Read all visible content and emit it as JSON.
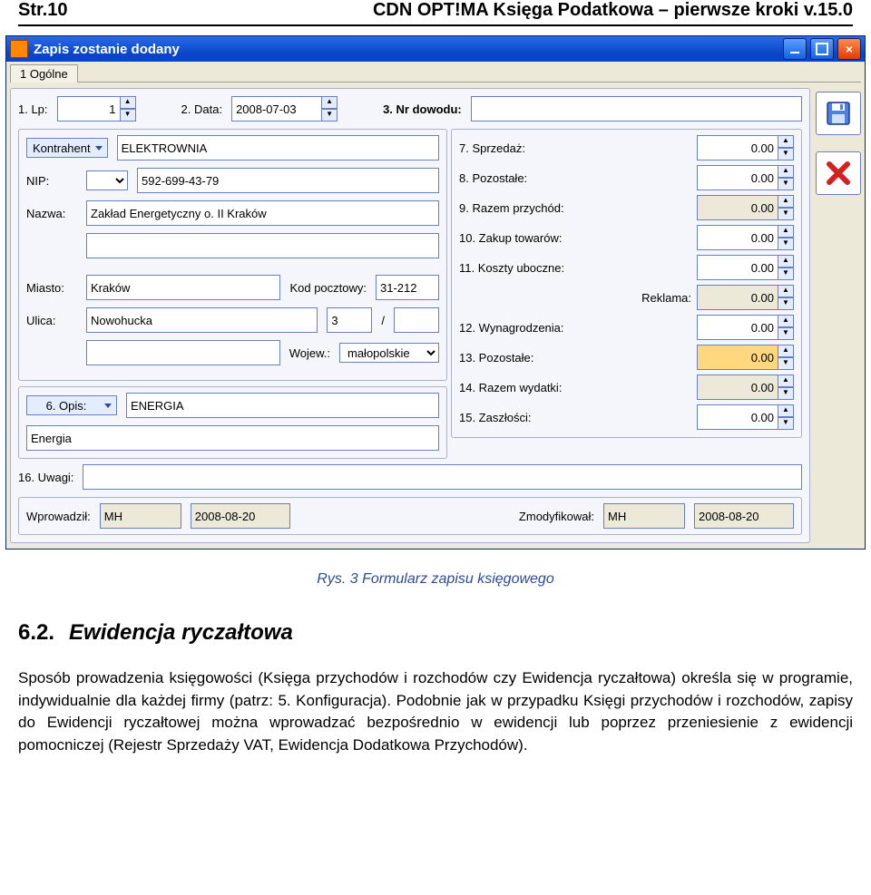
{
  "page": {
    "left_header": "Str.10",
    "right_header": "CDN OPT!MA Księga Podatkowa – pierwsze kroki v.15.0"
  },
  "window": {
    "title": "Zapis zostanie dodany",
    "tab": "1 Ogólne",
    "row1": {
      "lp_label": "1. Lp:",
      "lp_value": "1",
      "data_label": "2. Data:",
      "data_value": "2008-07-03",
      "nrdow_label": "3. Nr dowodu:",
      "nrdow_value": ""
    },
    "left": {
      "kontrahent_btn": "Kontrahent",
      "kontrahent_value": "ELEKTROWNIA",
      "nip_label": "NIP:",
      "nip_code": "",
      "nip_value": "592-699-43-79",
      "nazwa_label": "Nazwa:",
      "nazwa1": "Zakład Energetyczny o. II Kraków",
      "nazwa2": "",
      "miasto_label": "Miasto:",
      "miasto": "Kraków",
      "kod_label": "Kod pocztowy:",
      "kod": "31-212",
      "ulica_label": "Ulica:",
      "ulica": "Nowohucka",
      "ulica_nr1": "3",
      "ulica_sep": "/",
      "ulica_nr2": "",
      "wojew_label": "Wojew.:",
      "wojew": "małopolskie",
      "opis_btn": "6. Opis:",
      "opis_val": "ENERGIA",
      "opis2": "Energia"
    },
    "right": {
      "r7": {
        "label": "7. Sprzedaż:",
        "val": "0.00"
      },
      "r8": {
        "label": "8. Pozostałe:",
        "val": "0.00"
      },
      "r9": {
        "label": "9. Razem przychód:",
        "val": "0.00"
      },
      "r10": {
        "label": "10. Zakup towarów:",
        "val": "0.00"
      },
      "r11": {
        "label": "11. Koszty uboczne:",
        "val": "0.00"
      },
      "reklama": {
        "label": "Reklama:",
        "val": "0.00"
      },
      "r12": {
        "label": "12. Wynagrodzenia:",
        "val": "0.00"
      },
      "r13": {
        "label": "13. Pozostałe:",
        "val": "0.00"
      },
      "r14": {
        "label": "14. Razem wydatki:",
        "val": "0.00"
      },
      "r15": {
        "label": "15. Zaszłości:",
        "val": "0.00"
      }
    },
    "uwagi_label": "16. Uwagi:",
    "uwagi_value": "",
    "footer": {
      "wprowadzil_label": "Wprowadził:",
      "wprowadzil": "MH",
      "wprowadzil_date": "2008-08-20",
      "zmodyfikowal_label": "Zmodyfikował:",
      "zmodyfikowal": "MH",
      "zmodyfikowal_date": "2008-08-20"
    }
  },
  "caption": "Rys. 3 Formularz zapisu księgowego",
  "section": {
    "num": "6.2.",
    "title": "Ewidencja ryczałtowa",
    "body": "Sposób prowadzenia księgowości (Księga przychodów i rozchodów czy Ewidencja ryczałtowa) określa się w programie, indywidualnie dla każdej firmy (patrz: 5. Konfiguracja). Podobnie jak w przypadku Księgi przychodów i rozchodów, zapisy do Ewidencji ryczałtowej można wprowadzać bezpośrednio w ewidencji lub poprzez przeniesienie z ewidencji pomocniczej (Rejestr Sprzedaży VAT, Ewidencja Dodatkowa Przychodów)."
  }
}
